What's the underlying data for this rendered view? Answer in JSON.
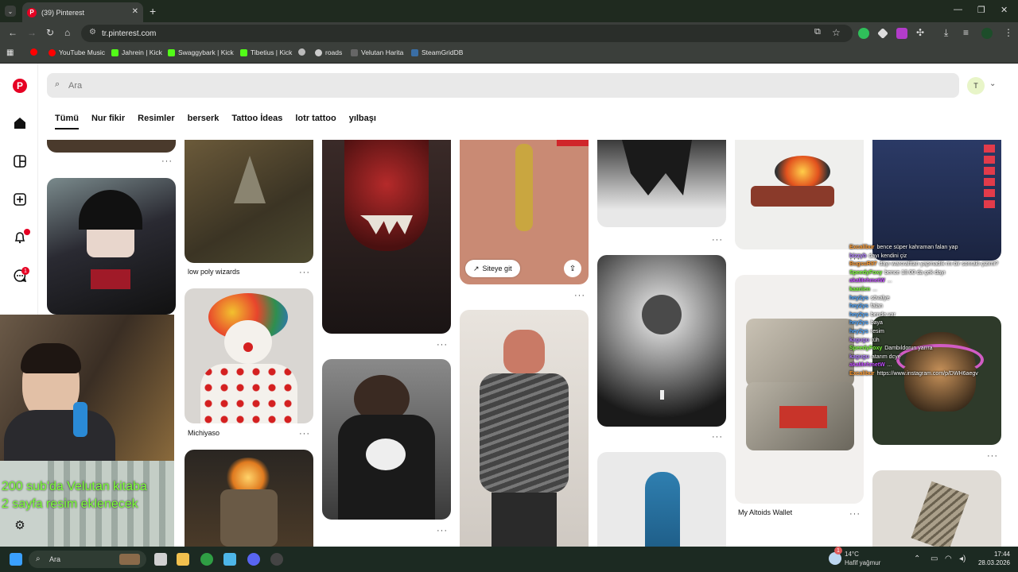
{
  "browser": {
    "tab_title": "(39) Pinterest",
    "url": "tr.pinterest.com",
    "bookmarks": [
      {
        "label": "YouTube Music",
        "color": "#ff0000"
      },
      {
        "label": "Jahrein | Kick",
        "color": "#53fc18"
      },
      {
        "label": "Swaggybark | Kick",
        "color": "#53fc18"
      },
      {
        "label": "Tibetius | Kick",
        "color": "#53fc18"
      },
      {
        "label": "roads",
        "color": "#cccccc"
      },
      {
        "label": "Velutan Harita",
        "color": "#666666"
      },
      {
        "label": "SteamGridDB",
        "color": "#3a6ea5"
      }
    ]
  },
  "pinterest": {
    "logo": "P",
    "search_placeholder": "Ara",
    "avatar_letter": "T",
    "notification_count": "1",
    "tabs": [
      "Tümü",
      "Nur fikir",
      "Resimler",
      "berserk",
      "Tattoo İdeas",
      "lotr tattoo",
      "yılbaşı"
    ],
    "captions": {
      "low_poly": "low poly wizards",
      "clown": "Michiyaso",
      "altoids": "My Altoids Wallet"
    },
    "visit_label": "Siteye git",
    "more_label": "···"
  },
  "overlay": {
    "promo_line1": "200 sub'da Velutan kitaba",
    "promo_line2": "2 sayfa resim eklenecek",
    "chat": [
      {
        "name": "Excalibur",
        "name_color": "#ff9a2e",
        "text": "bence süper kahraman falan yap"
      },
      {
        "name": "bizzyb",
        "name_color": "#b07cff",
        "text": "dayı kendini çiz"
      },
      {
        "name": "BugsuR97",
        "name_color": "#ff9a2e",
        "text": "dayı warcrafttan yapmadık mı bir sonraki çizimi?"
      },
      {
        "name": "SpeedyFoxy",
        "name_color": "#7dff3a",
        "text": "bence 18.00 da çek dayı"
      },
      {
        "name": "akaMehmetW",
        "name_color": "#c24dff",
        "text": "..."
      },
      {
        "name": "kaanlen",
        "name_color": "#7dff3a",
        "text": "..."
      },
      {
        "name": "hey2ys",
        "name_color": "#4da6ff",
        "text": "sövalye"
      },
      {
        "name": "hey2ys",
        "name_color": "#4da6ff",
        "text": "falan"
      },
      {
        "name": "hey2ys",
        "name_color": "#4da6ff",
        "text": "bende var"
      },
      {
        "name": "hey2ys",
        "name_color": "#4da6ff",
        "text": "baya"
      },
      {
        "name": "hey2ys",
        "name_color": "#4da6ff",
        "text": "resim"
      },
      {
        "name": "kagugu",
        "name_color": "#b07cff",
        "text": "tüh"
      },
      {
        "name": "SpeedyFoxy",
        "name_color": "#7dff3a",
        "text": "Dambıldorun yarrra"
      },
      {
        "name": "kagugu",
        "name_color": "#b07cff",
        "text": "atarım dcye"
      },
      {
        "name": "akaMehmetW",
        "name_color": "#c24dff",
        "text": "..."
      },
      {
        "name": "Excalibur",
        "name_color": "#ff9a2e",
        "text": "https://www.instagram.com/p/DWH6aegv"
      }
    ]
  },
  "taskbar": {
    "search_label": "Ara",
    "weather_temp": "14°C",
    "weather_desc": "Hafif yağmur",
    "time": "17:44",
    "date": "28.03.2026",
    "badge_count": "1"
  }
}
